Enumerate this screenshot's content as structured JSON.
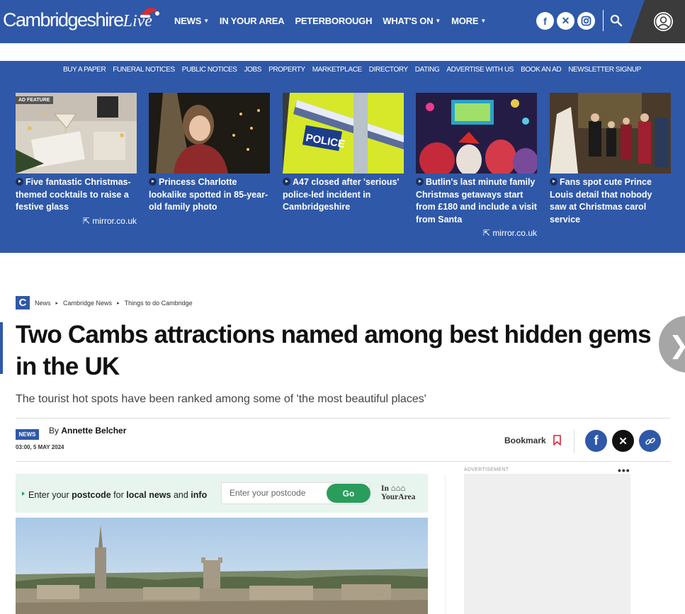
{
  "header": {
    "logo_main": "CambridgeshireLive",
    "logo_part1": "Cambridgeshire",
    "logo_part2": "Live",
    "nav": [
      {
        "label": "NEWS",
        "dropdown": true
      },
      {
        "label": "IN YOUR AREA",
        "dropdown": false
      },
      {
        "label": "PETERBOROUGH",
        "dropdown": false
      },
      {
        "label": "WHAT'S ON",
        "dropdown": true
      },
      {
        "label": "MORE",
        "dropdown": true
      }
    ],
    "social_icons": [
      "facebook-icon",
      "x-icon",
      "instagram-icon"
    ],
    "brand_color": "#2f58a8"
  },
  "subnav": [
    "BUY A PAPER",
    "FUNERAL NOTICES",
    "PUBLIC NOTICES",
    "JOBS",
    "PROPERTY",
    "MARKETPLACE",
    "DIRECTORY",
    "DATING",
    "ADVERTISE WITH US",
    "BOOK AN AD",
    "NEWSLETTER SIGNUP"
  ],
  "cards": [
    {
      "headline": "Five fantastic Christmas-themed cocktails to raise a festive glass",
      "source": "mirror.co.uk",
      "tag": "AD FEATURE"
    },
    {
      "headline": "Princess Charlotte lookalike spotted in 85-year-old family photo",
      "source": "",
      "tag": ""
    },
    {
      "headline": "A47 closed after 'serious' police-led incident in Cambridgeshire",
      "source": "",
      "tag": ""
    },
    {
      "headline": "Butlin's last minute family Christmas getaways start from £180 and include a visit from Santa",
      "source": "mirror.co.uk",
      "tag": ""
    },
    {
      "headline": "Fans spot cute Prince Louis detail that nobody saw at Christmas carol service",
      "source": "",
      "tag": ""
    }
  ],
  "article": {
    "site_initial": "C",
    "breadcrumbs": [
      "News",
      "Cambridge News",
      "Things to do Cambridge"
    ],
    "title": "Two Cambs attractions named among best hidden gems in the UK",
    "standfirst": "The tourist hot spots have been ranked among some of 'the most beautiful places'",
    "badge": "NEWS",
    "by": "By",
    "author": "Annette Belcher",
    "date": "03:00, 5 MAY 2024",
    "bookmark_label": "Bookmark"
  },
  "postcode": {
    "text_parts": [
      "Enter your ",
      "postcode",
      " for ",
      "local news",
      " and ",
      "info"
    ],
    "placeholder": "Enter your postcode",
    "button": "Go",
    "brand_line1": "In",
    "brand_line2": "YourArea",
    "accent": "#2a9d5c"
  },
  "sidebar": {
    "ad_label": "ADVERTISEMENT",
    "menu_dots": "•••"
  }
}
